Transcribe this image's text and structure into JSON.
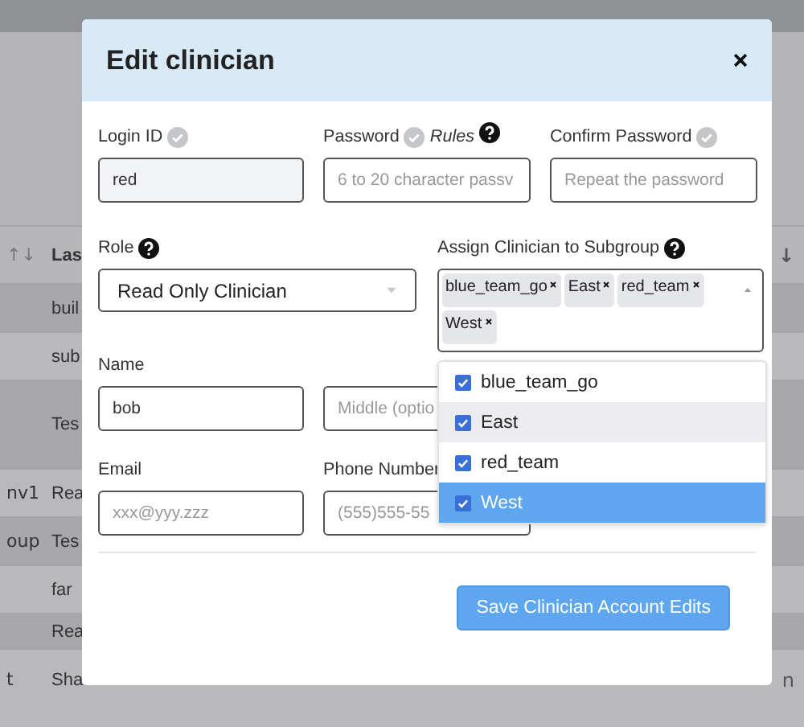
{
  "background_table": {
    "header": {
      "sort": "↑↓",
      "column_2": "Las",
      "right_sort": "↓"
    },
    "rows": [
      {
        "column_1": "",
        "column_2": "buil",
        "column_last": ""
      },
      {
        "column_1": "",
        "column_2": "sub",
        "column_last": ""
      },
      {
        "column_1": "",
        "column_2": "Tes",
        "column_last": ""
      },
      {
        "column_1": "nv1",
        "column_2": "Rea",
        "column_last": ""
      },
      {
        "column_1": "oup",
        "column_2": "Tes",
        "column_last": ""
      },
      {
        "column_1": "",
        "column_2": "far",
        "column_last": ""
      },
      {
        "column_1": "",
        "column_2": "Rea",
        "column_last": ""
      },
      {
        "column_1": "t",
        "column_2": "Sha",
        "column_last": "n"
      }
    ]
  },
  "modal": {
    "title": "Edit clinician",
    "login_id": {
      "label": "Login ID",
      "value": "red"
    },
    "password": {
      "label": "Password",
      "rules": "Rules",
      "placeholder": "6 to 20 character passv"
    },
    "confirm_password": {
      "label": "Confirm Password",
      "placeholder": "Repeat the password"
    },
    "role": {
      "label": "Role",
      "value": "Read Only Clinician"
    },
    "subgroup": {
      "label": "Assign Clinician to Subgroup",
      "tags": [
        "blue_team_go",
        "East",
        "red_team",
        "West"
      ],
      "options": [
        {
          "label": "blue_team_go",
          "checked": true,
          "hovered": false,
          "selected": false
        },
        {
          "label": "East",
          "checked": true,
          "hovered": true,
          "selected": false
        },
        {
          "label": "red_team",
          "checked": true,
          "hovered": false,
          "selected": false
        },
        {
          "label": "West",
          "checked": true,
          "hovered": false,
          "selected": true
        }
      ]
    },
    "name": {
      "label": "Name",
      "first": "bob",
      "middle_placeholder": "Middle (optio"
    },
    "email": {
      "label": "Email",
      "placeholder": "xxx@yyy.zzz"
    },
    "phone": {
      "label": "Phone Number",
      "placeholder": "(555)555-55"
    },
    "save_button": "Save Clinician Account Edits"
  }
}
